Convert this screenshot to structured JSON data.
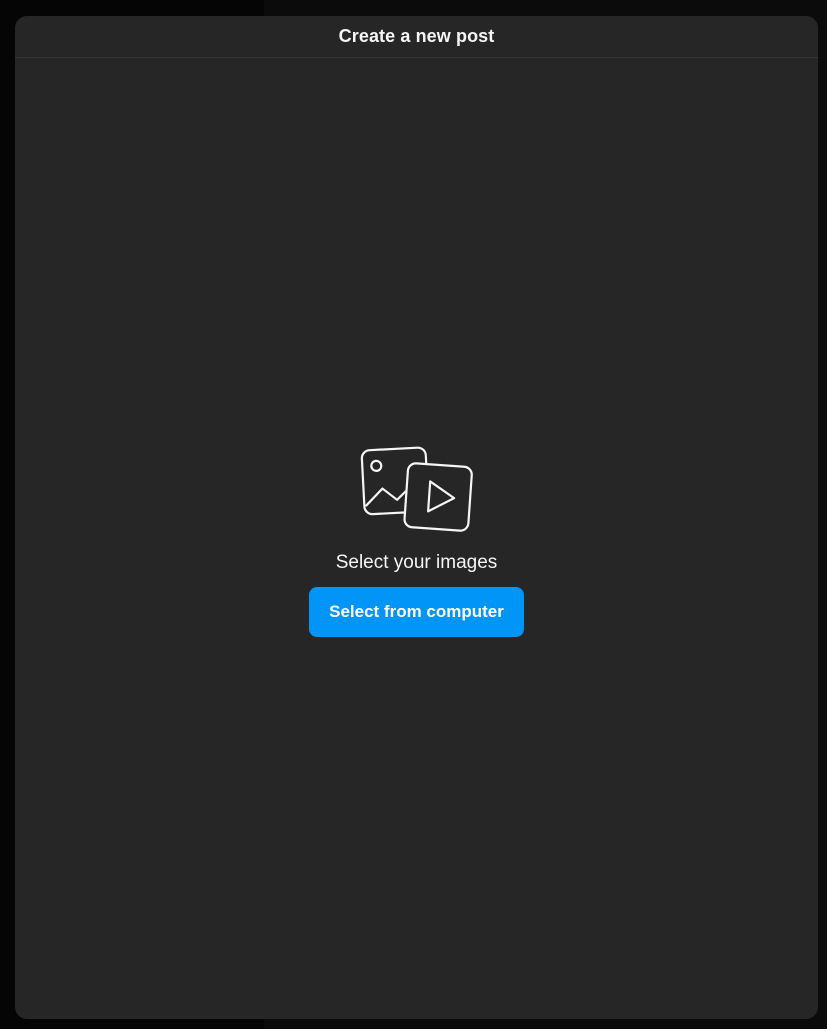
{
  "modal": {
    "title": "Create a new post"
  },
  "upload": {
    "icon": "photo-video-icon",
    "prompt": "Select your images",
    "button_label": "Select from computer"
  },
  "colors": {
    "accent": "#0095f6",
    "modal_background": "#262626",
    "text_primary": "#f5f5f5"
  }
}
